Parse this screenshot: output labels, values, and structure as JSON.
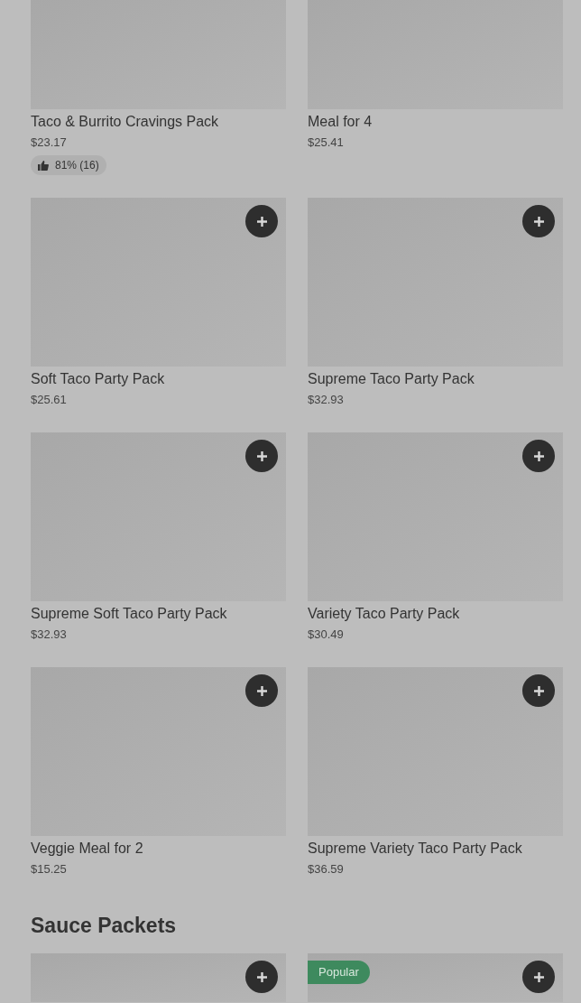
{
  "sections": [
    {
      "rows": [
        [
          {
            "name": "Taco & Burrito Cravings Pack",
            "price": "$23.17",
            "rating": "81% (16)"
          },
          {
            "name": "Meal for 4",
            "price": "$25.41"
          }
        ],
        [
          {
            "name": "Soft Taco Party Pack",
            "price": "$25.61",
            "add_button": true
          },
          {
            "name": "Supreme Taco Party Pack",
            "price": "$32.93",
            "add_button": true
          }
        ],
        [
          {
            "name": "Supreme Soft Taco Party Pack",
            "price": "$32.93",
            "add_button": true
          },
          {
            "name": "Variety Taco Party Pack",
            "price": "$30.49",
            "add_button": true
          }
        ],
        [
          {
            "name": "Veggie Meal for 2",
            "price": "$15.25",
            "add_button": true
          },
          {
            "name": "Supreme Variety Taco Party Pack",
            "price": "$36.59",
            "add_button": true
          }
        ]
      ]
    },
    {
      "title": "Sauce Packets",
      "rows": [
        [
          {
            "add_button": true
          },
          {
            "badge": "Popular",
            "add_button": true
          }
        ]
      ]
    }
  ]
}
